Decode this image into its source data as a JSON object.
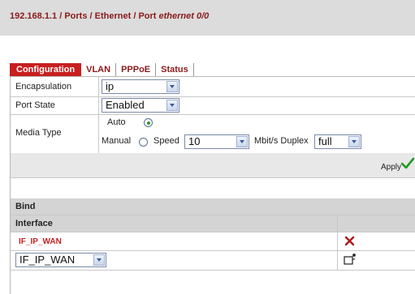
{
  "breadcrumb": {
    "host": "192.168.1.1",
    "sep": "/",
    "path1": "Ports",
    "path2": "Ethernet",
    "last_prefix": "Port",
    "last_name": "ethernet 0/0"
  },
  "tabs": [
    {
      "label": "Configuration",
      "active": true
    },
    {
      "label": "VLAN",
      "active": false
    },
    {
      "label": "PPPoE",
      "active": false
    },
    {
      "label": "Status",
      "active": false
    }
  ],
  "form": {
    "encapsulation": {
      "label": "Encapsulation",
      "value": "ip"
    },
    "port_state": {
      "label": "Port State",
      "value": "Enabled"
    },
    "media_type": {
      "label": "Media Type",
      "auto_label": "Auto",
      "manual_label": "Manual",
      "speed_label": "Speed",
      "speed_value": "10",
      "unit_duplex_label": "Mbit/s Duplex",
      "duplex_value": "full",
      "selected": "auto"
    },
    "apply_label": "Apply"
  },
  "bind": {
    "title": "Bind",
    "column_header": "Interface",
    "rows": [
      {
        "interface": "IF_IP_WAN"
      }
    ],
    "new_select_value": "IF_IP_WAN"
  },
  "colors": {
    "accent": "#c81f1f",
    "crumb_text": "#8b1a1a",
    "apply_check": "#1f9a1f"
  }
}
